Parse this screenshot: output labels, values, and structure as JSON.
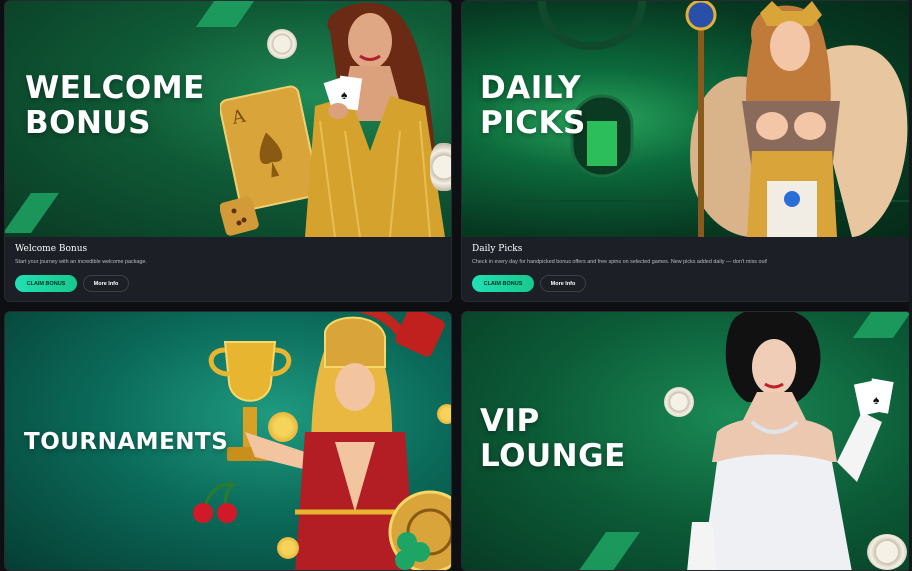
{
  "cards": [
    {
      "banner_title_lines": [
        "WELCOME",
        "BONUS"
      ],
      "title": "Welcome Bonus",
      "description": "Start your journey with an incredible welcome package.",
      "primary_button": "CLAIM BONUS",
      "secondary_button": "More Info"
    },
    {
      "banner_title_lines": [
        "DAILY",
        "PICKS"
      ],
      "title": "Daily Picks",
      "description": "Check in every day for handpicked bonus offers and free spins on selected games. New picks added daily — don't miss out!",
      "primary_button": "CLAIM BONUS",
      "secondary_button": "More Info"
    },
    {
      "banner_title_lines": [
        "TOURNAMENTS"
      ]
    },
    {
      "banner_title_lines": [
        "VIP",
        "LOUNGE"
      ]
    }
  ],
  "colors": {
    "accent_green": "#1ea464",
    "claim_button": "#21e0b4",
    "card_bg": "#1c1f26"
  }
}
